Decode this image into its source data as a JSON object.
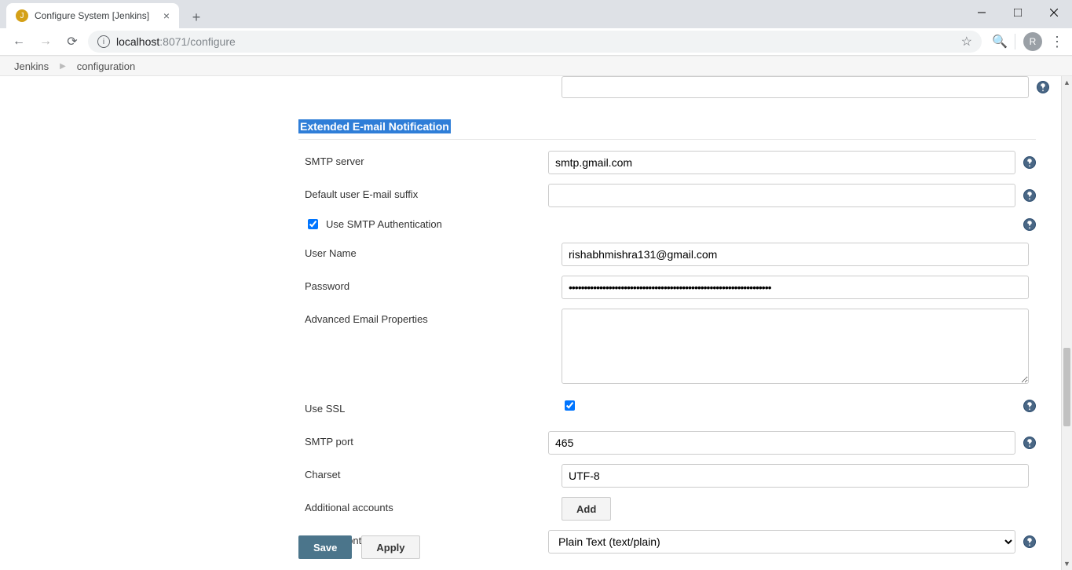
{
  "browser": {
    "tab_title": "Configure System [Jenkins]",
    "url_host": "localhost",
    "url_rest": ":8071/configure",
    "avatar_letter": "R"
  },
  "breadcrumb": {
    "root": "Jenkins",
    "current": "configuration"
  },
  "section_title": "Extended E-mail Notification",
  "fields": {
    "smtp_server": {
      "label": "SMTP server",
      "value": "smtp.gmail.com"
    },
    "default_suffix": {
      "label": "Default user E-mail suffix",
      "value": ""
    },
    "use_smtp_auth": {
      "label": "Use SMTP Authentication",
      "checked": true
    },
    "user_name": {
      "label": "User Name",
      "value": "rishabhmishra131@gmail.com"
    },
    "password": {
      "label": "Password",
      "value": "••••••••••••••••••••••••••••••••••••••••••••••••••••••••••••••••••"
    },
    "adv_props": {
      "label": "Advanced Email Properties",
      "value": ""
    },
    "use_ssl": {
      "label": "Use SSL",
      "checked": true
    },
    "smtp_port": {
      "label": "SMTP port",
      "value": "465"
    },
    "charset": {
      "label": "Charset",
      "value": "UTF-8"
    },
    "additional_accounts": {
      "label": "Additional accounts",
      "button": "Add"
    },
    "default_content_type": {
      "label": "Default Content Type",
      "value": "Plain Text (text/plain)"
    }
  },
  "buttons": {
    "save": "Save",
    "apply": "Apply"
  }
}
